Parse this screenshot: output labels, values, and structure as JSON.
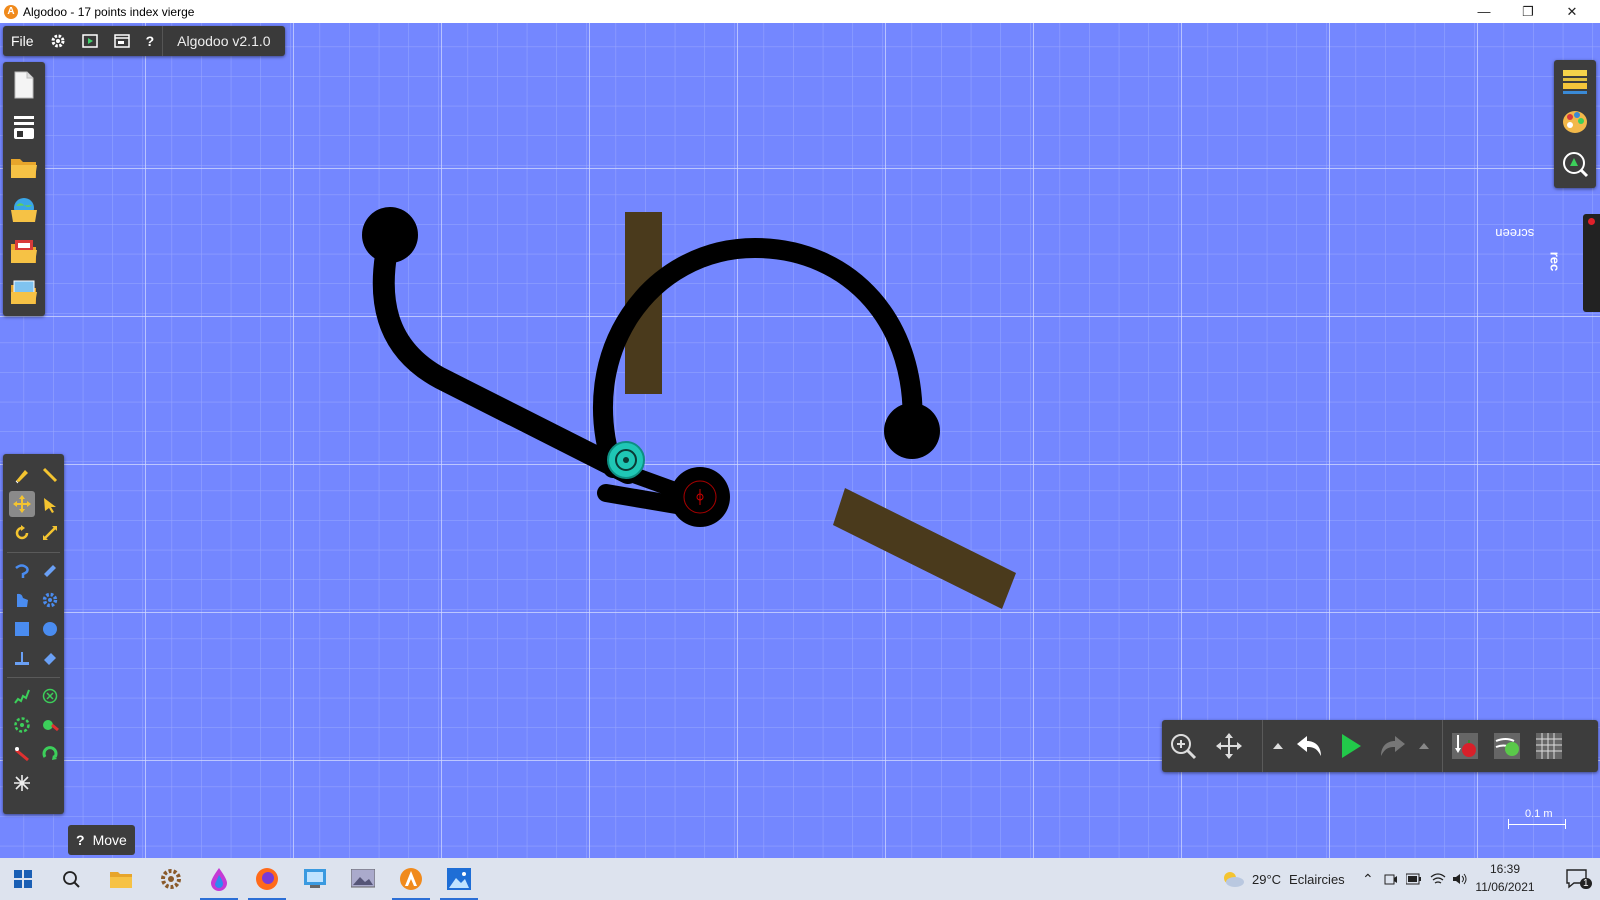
{
  "window": {
    "title": "Algodoo - 17 points index vierge",
    "minimize": "—",
    "maximize": "❐",
    "close": "✕"
  },
  "menubar": {
    "file": "File",
    "help": "?",
    "version": "Algodoo v2.1.0"
  },
  "hint": {
    "icon": "?",
    "label": "Move"
  },
  "scale": {
    "label": "0.1 m"
  },
  "screenrec": {
    "label_light": "screen",
    "label_bold": "rec"
  },
  "taskbar": {
    "weather_temp": "29°C",
    "weather_text": "Eclaircies",
    "time": "16:39",
    "date": "11/06/2021",
    "notifications": "1"
  },
  "colors": {
    "canvas_bg": "#7487ff",
    "grid": "#c9d1ff",
    "rod": "#000000",
    "plank": "#4a3a1c",
    "motor": "#1fc7b5",
    "panel": "#3d3d3d"
  },
  "icons": {
    "left_top": [
      "new-scene-icon",
      "layers-icon",
      "open-folder-icon",
      "algobox-icon",
      "folder-photos-icon",
      "folder-screenshots-icon"
    ],
    "tools": [
      "sketch-icon",
      "cut-icon",
      "move-icon",
      "drag-icon",
      "rotate-icon",
      "scale-icon",
      "rope-icon",
      "plane-icon",
      "polygon-icon",
      "gear-icon",
      "box-icon",
      "circle-icon",
      "chain-icon",
      "brush-icon",
      "spring-icon",
      "fixate-icon",
      "hinge-icon",
      "tracer-icon",
      "laser-icon",
      "thruster-icon",
      "fill-icon"
    ],
    "right": [
      "background-layers-icon",
      "palette-icon",
      "zoom-settings-icon"
    ],
    "playbar": [
      "zoom-icon",
      "pan-icon",
      "undo-menu-icon",
      "undo-icon",
      "play-icon",
      "redo-icon",
      "redo-menu-icon",
      "gravity-icon",
      "air-friction-icon",
      "grid-icon"
    ]
  }
}
